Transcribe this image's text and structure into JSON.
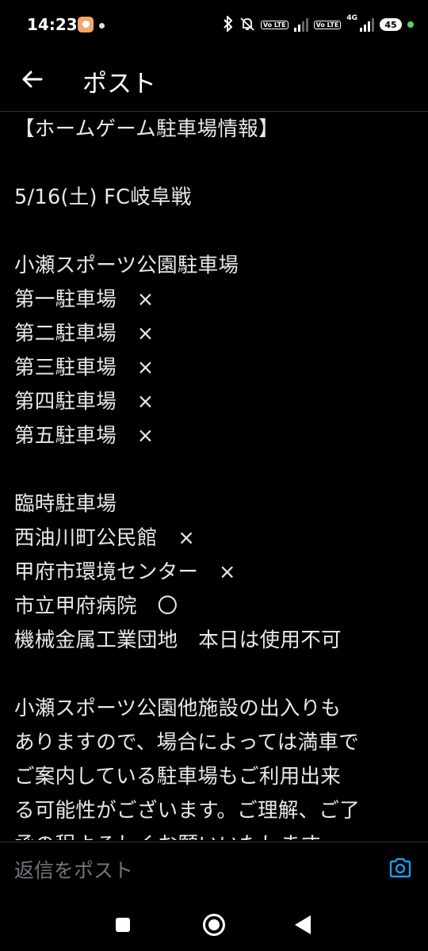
{
  "status_bar": {
    "time": "14:23",
    "icons": [
      "app-notification-icon",
      "dot-icon",
      "bluetooth-icon",
      "mute-icon",
      "volte-icon",
      "signal-icon",
      "volte-icon",
      "signal-4g-icon",
      "battery-icon"
    ],
    "volte_label": "Vo LTE",
    "network_label": "4G",
    "battery_level": "45",
    "charging_color": "#4cd964"
  },
  "header": {
    "title": "ポスト"
  },
  "post": {
    "lines": [
      "【ホームゲーム駐車場情報】",
      "",
      "5/16(土) FC岐阜戦",
      "",
      "小瀬スポーツ公園駐車場",
      "第一駐車場　×",
      "第二駐車場　×",
      "第三駐車場　×",
      "第四駐車場　×",
      "第五駐車場　×",
      "",
      "臨時駐車場",
      "西油川町公民館　×",
      "甲府市環境センター　×",
      "市立甲府病院　〇",
      "機械金属工業団地　本日は使用不可",
      "",
      "小瀬スポーツ公園他施設の出入りも",
      "ありますので、場合によっては満車で",
      "ご案内している駐車場もご利用出来",
      "る可能性がございます。ご理解、ご了",
      "承の程よろしくお願いいたします。"
    ]
  },
  "reply": {
    "placeholder": "返信をポスト"
  },
  "colors": {
    "background": "#000000",
    "text": "#e7e9ea",
    "muted": "#71767b",
    "accent": "#1d9bf0",
    "divider": "#2f3336"
  }
}
